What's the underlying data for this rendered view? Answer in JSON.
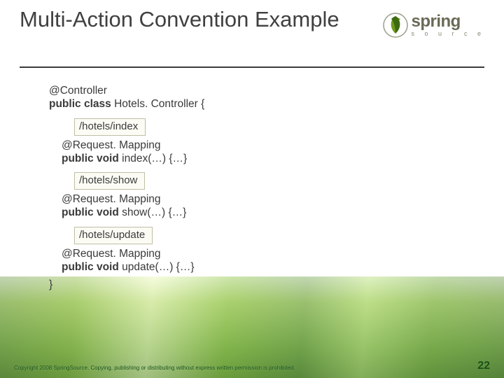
{
  "title": "Multi-Action Convention Example",
  "logo": {
    "brand": "spring",
    "sub": "s o u r c e"
  },
  "code": {
    "ann_controller": "@Controller",
    "kw_public": "public",
    "kw_class": "class",
    "class_name": "Hotels. Controller {",
    "box1": "/hotels/index",
    "ann1": "@Request. Mapping",
    "kw_void": "void",
    "m1": "index(…) {…}",
    "box2": "/hotels/show",
    "ann2": "@Request. Mapping",
    "m2": "show(…) {…}",
    "box3": "/hotels/update",
    "ann3": "@Request. Mapping",
    "m3": "update(…) {…}",
    "close": "}"
  },
  "footer": {
    "copyright": "Copyright 2008 SpringSource.  Copying, publishing or distributing without express written permission is prohibited.",
    "page": "22"
  },
  "colors": {
    "accent": "#5a8a00"
  }
}
